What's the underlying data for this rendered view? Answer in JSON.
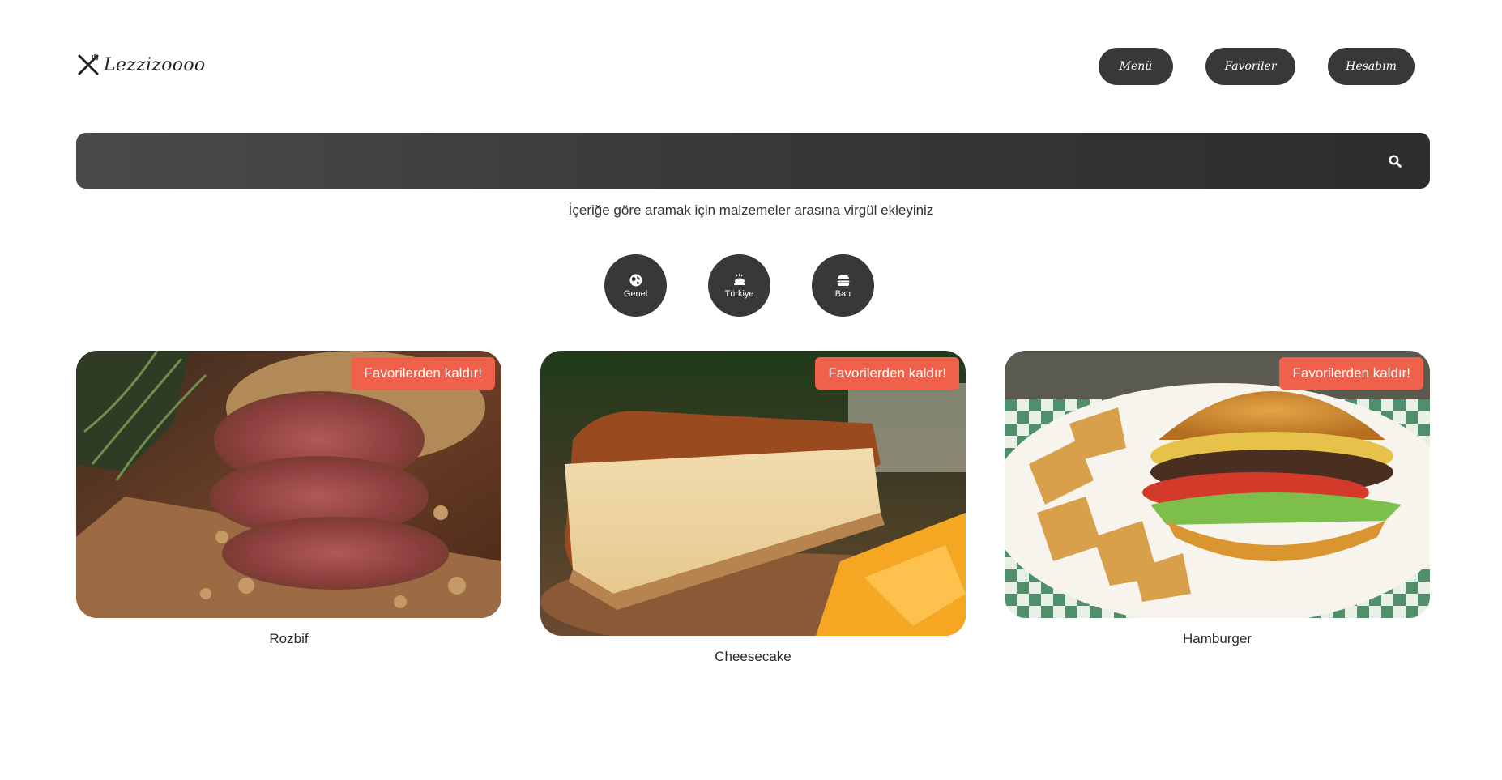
{
  "header": {
    "logo_text": "Lezzizoooo",
    "nav": [
      {
        "label": "Menü"
      },
      {
        "label": "Favoriler"
      },
      {
        "label": "Hesabım"
      }
    ]
  },
  "search": {
    "value": "",
    "placeholder": "",
    "hint": "İçeriğe göre aramak için malzemeler arasına virgül ekleyiniz"
  },
  "categories": [
    {
      "label": "Genel",
      "icon": "globe-icon"
    },
    {
      "label": "Türkiye",
      "icon": "turkey-dish-icon"
    },
    {
      "label": "Batı",
      "icon": "burger-icon"
    }
  ],
  "cards": [
    {
      "title": "Rozbif",
      "badge": "Favorilerden kaldır!",
      "image": "roast-beef-image"
    },
    {
      "title": "Cheesecake",
      "badge": "Favorilerden kaldır!",
      "image": "cheesecake-image"
    },
    {
      "title": "Hamburger",
      "badge": "Favorilerden kaldır!",
      "image": "hamburger-image"
    }
  ],
  "colors": {
    "dark": "#383838",
    "accent": "#f0614b",
    "text": "#2b2b2b"
  }
}
